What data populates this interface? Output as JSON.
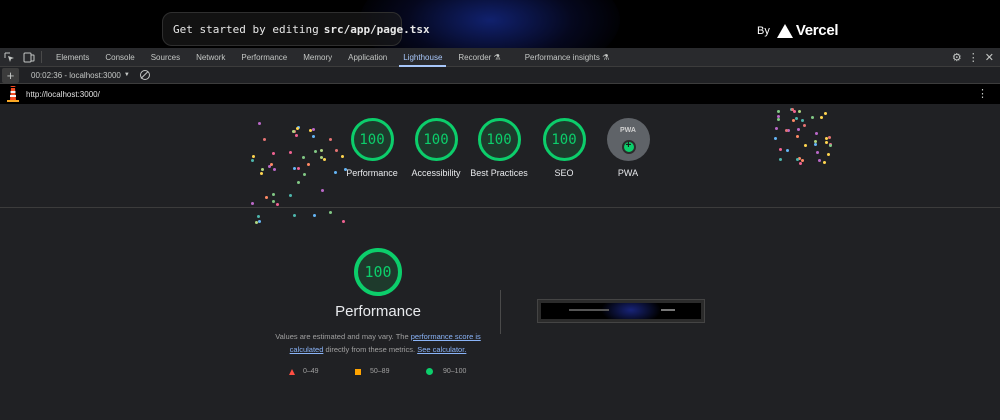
{
  "page_header": {
    "get_started_prefix": "Get started by editing",
    "get_started_file": "src/app/page.tsx",
    "by_label": "By",
    "brand": "Vercel"
  },
  "devtools": {
    "tabs": [
      {
        "label": "Elements"
      },
      {
        "label": "Console"
      },
      {
        "label": "Sources"
      },
      {
        "label": "Network"
      },
      {
        "label": "Performance"
      },
      {
        "label": "Memory"
      },
      {
        "label": "Application"
      },
      {
        "label": "Lighthouse"
      },
      {
        "label": "Recorder ⚗"
      },
      {
        "label": "Performance insights ⚗"
      }
    ],
    "active_tab": "Lighthouse"
  },
  "lighthouse_toolbar": {
    "add_label": "+",
    "report_select": "00:02:36 - localhost:3000"
  },
  "url_bar": {
    "url": "http://localhost:3000/"
  },
  "gauges": [
    {
      "score": "100",
      "label": "Performance"
    },
    {
      "score": "100",
      "label": "Accessibility"
    },
    {
      "score": "100",
      "label": "Best Practices"
    },
    {
      "score": "100",
      "label": "SEO"
    }
  ],
  "pwa": {
    "badge_text": "PWA",
    "label": "PWA"
  },
  "performance": {
    "score": "100",
    "title": "Performance",
    "desc_prefix": "Values are estimated and may vary. The",
    "link_score": "performance score is calculated",
    "desc_middle": "directly from these metrics.",
    "link_calc": "See calculator."
  },
  "legend": [
    {
      "shape": "triangle",
      "range": "0–49",
      "color": "#ff4e42"
    },
    {
      "shape": "square",
      "range": "50–89",
      "color": "#ffa400"
    },
    {
      "shape": "circle",
      "range": "90–100",
      "color": "#0cce6b"
    }
  ],
  "colors": {
    "pass": "#0cce6b",
    "link": "#8ab4f8",
    "active_tab": "#a8c7fa"
  }
}
